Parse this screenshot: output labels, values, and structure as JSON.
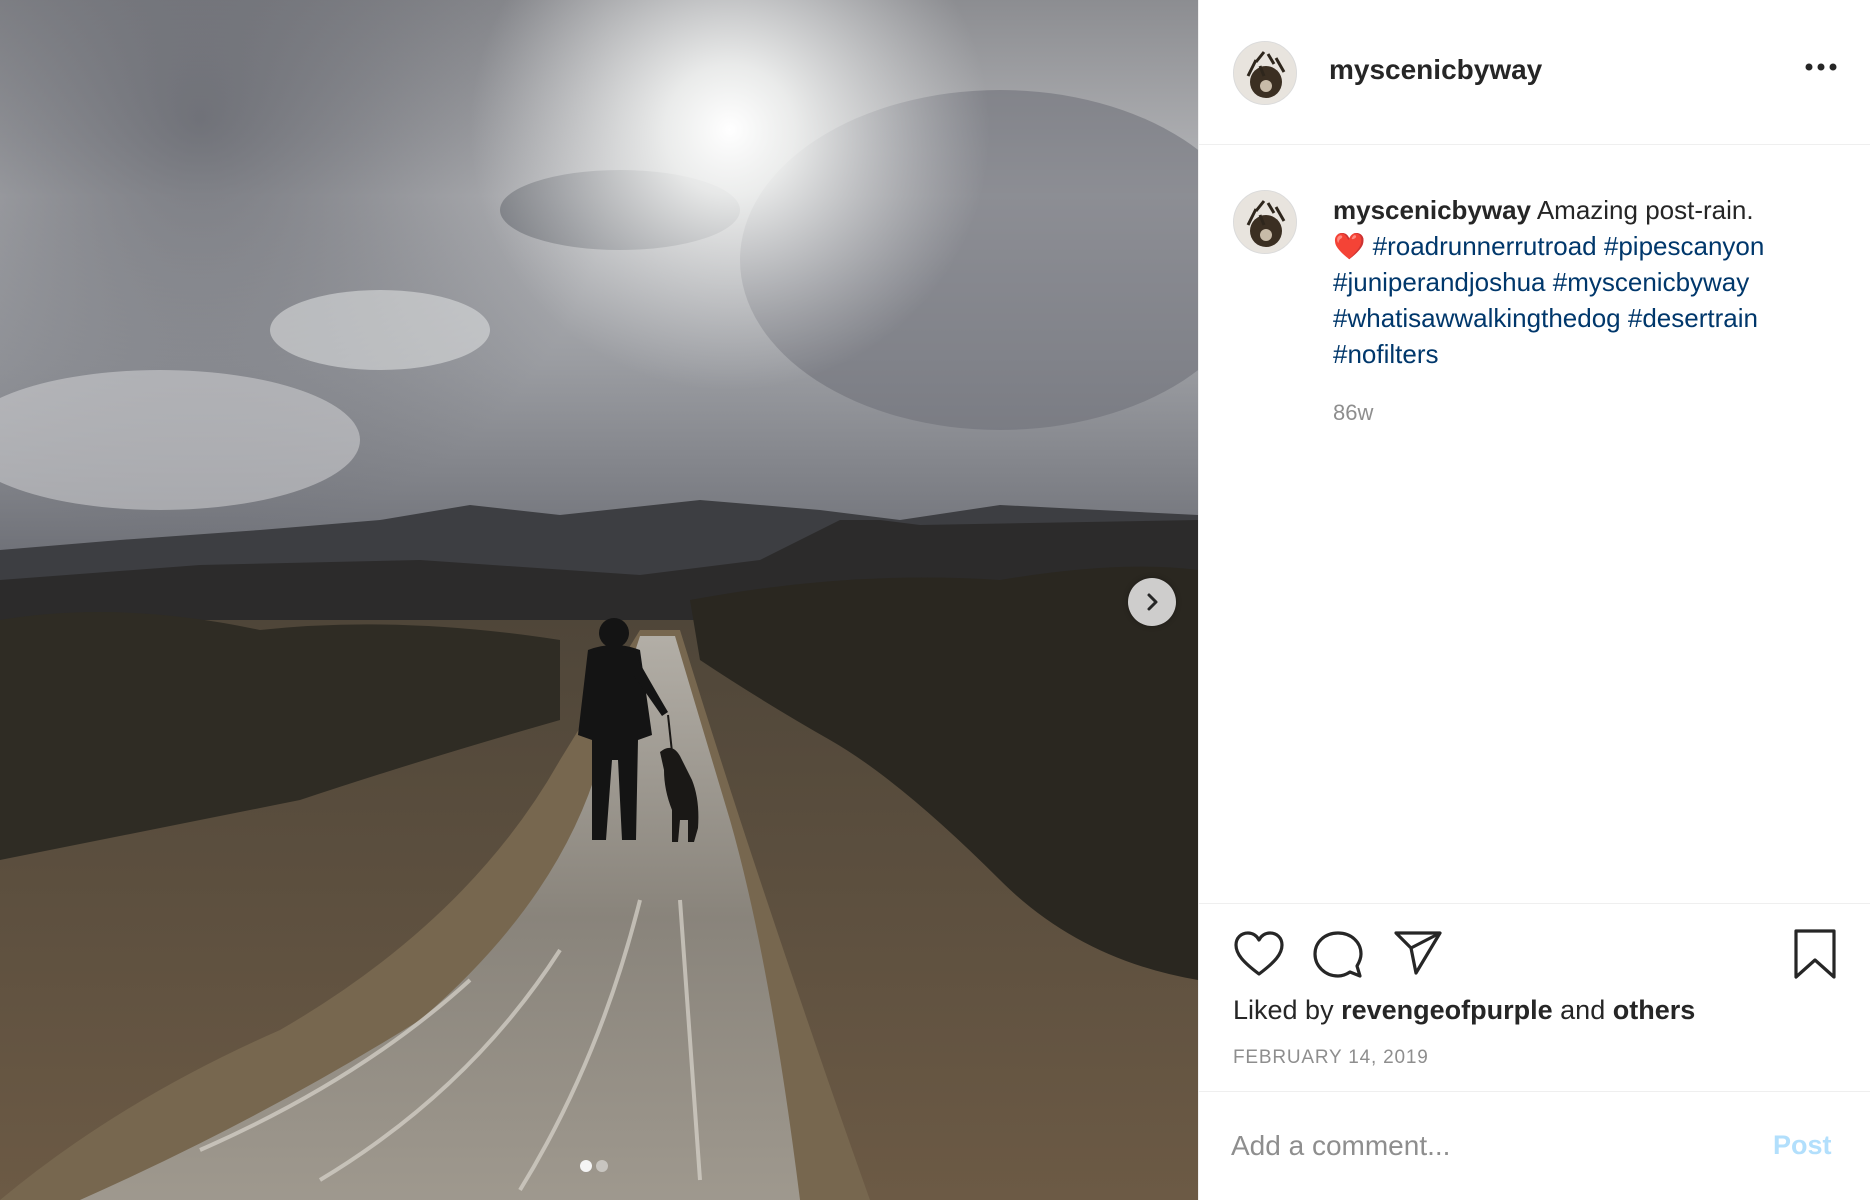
{
  "post": {
    "username": "myscenicbyway",
    "caption": {
      "username": "myscenicbyway",
      "text": "Amazing post-rain.",
      "emoji": "❤️",
      "hashtags": [
        "#roadrunnerrutroad",
        "#pipescanyon",
        "#juniperandjoshua",
        "#myscenicbyway",
        "#whatisawwalkingthedog",
        "#desertrain",
        "#nofilters"
      ]
    },
    "time_ago": "86w",
    "likes": {
      "prefix": "Liked by",
      "user": "revengeofpurple",
      "middle": "and",
      "others": "others"
    },
    "date": "FEBRUARY 14, 2019",
    "carousel": {
      "count": 2,
      "active": 1
    }
  },
  "comment_box": {
    "placeholder": "Add a comment...",
    "post_label": "Post"
  },
  "icons": {
    "more": "more-options-icon",
    "like": "heart-icon",
    "comment": "comment-icon",
    "share": "paper-plane-icon",
    "save": "bookmark-icon",
    "next": "chevron-right-icon"
  },
  "colors": {
    "hashtag": "#00376b",
    "meta_gray": "#8e8e8e",
    "post_button_disabled": "#b2dffc",
    "text": "#262626"
  }
}
